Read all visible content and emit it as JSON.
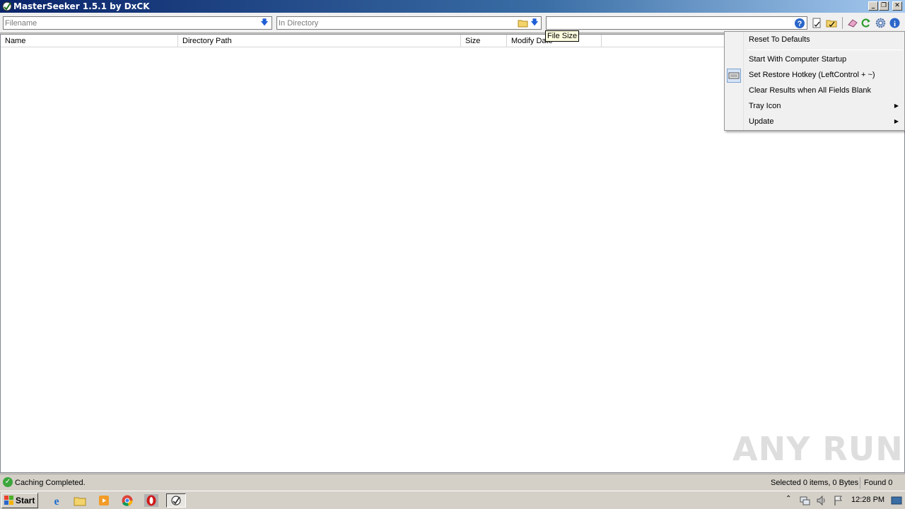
{
  "window": {
    "title": "MasterSeeker 1.5.1 by DxCK",
    "controls": [
      "minimize",
      "restore",
      "close"
    ]
  },
  "toolbar": {
    "filename_placeholder": "Filename",
    "filename_value": "",
    "directory_placeholder": "In Directory",
    "directory_value": "",
    "size_value": "",
    "icons": [
      "help-icon",
      "file-select-icon",
      "folder-open-icon",
      "eraser-icon",
      "refresh-icon",
      "settings-icon",
      "info-icon"
    ]
  },
  "tooltip": "File Size",
  "columns": [
    "Name",
    "Directory Path",
    "Size",
    "Modify Date"
  ],
  "menu": {
    "items": [
      {
        "label": "Reset To Defaults",
        "submenu": false,
        "checked": false
      },
      {
        "label": "Start With Computer Startup",
        "submenu": false,
        "checked": false
      },
      {
        "label": "Set Restore Hotkey (LeftControl + ~)",
        "submenu": false,
        "checked": true
      },
      {
        "label": "Clear Results when All Fields Blank",
        "submenu": false,
        "checked": false
      },
      {
        "label": "Tray Icon",
        "submenu": true,
        "checked": false
      },
      {
        "label": "Update",
        "submenu": true,
        "checked": false
      }
    ]
  },
  "status": {
    "message": "Caching Completed.",
    "selected": "Selected 0 items, 0 Bytes",
    "found": "Found 0"
  },
  "taskbar": {
    "start_label": "Start",
    "apps": [
      "ie-icon",
      "explorer-icon",
      "media-player-icon",
      "chrome-icon",
      "opera-icon",
      "masterseeker-icon"
    ],
    "clock": "12:28 PM"
  },
  "watermark": "ANY RUN"
}
